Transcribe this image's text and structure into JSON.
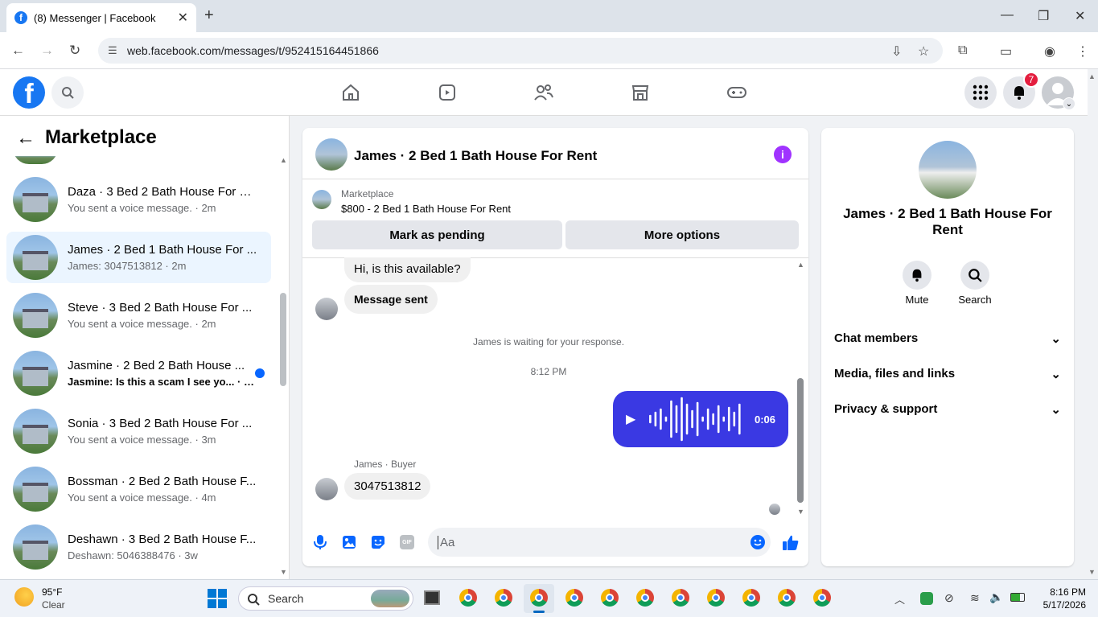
{
  "browser": {
    "tab_title": "(8) Messenger | Facebook",
    "favicon": "f",
    "url": "web.facebook.com/messages/t/952415164451866"
  },
  "fb_header": {
    "logo": "f",
    "notification_count": "7"
  },
  "left_panel": {
    "title": "Marketplace",
    "conversations": [
      {
        "name": "Daza · 3 Bed 2 Bath House For R...",
        "preview": "You sent a voice message. · 2m",
        "selected": false,
        "unread": false
      },
      {
        "name": "James · 2 Bed 1 Bath House For ...",
        "preview": "James: 3047513812 · 2m",
        "selected": true,
        "unread": false
      },
      {
        "name": "Steve · 3 Bed 2 Bath House For ...",
        "preview": "You sent a voice message. · 2m",
        "selected": false,
        "unread": false
      },
      {
        "name": "Jasmine · 2 Bed 2 Bath House ...",
        "preview": "Jasmine: Is this a scam I see yo... · 3m",
        "selected": false,
        "unread": true
      },
      {
        "name": "Sonia · 3 Bed 2 Bath House For ...",
        "preview": "You sent a voice message. · 3m",
        "selected": false,
        "unread": false
      },
      {
        "name": "Bossman · 2 Bed 2 Bath House F...",
        "preview": "You sent a voice message. · 4m",
        "selected": false,
        "unread": false
      },
      {
        "name": "Deshawn · 3 Bed 2 Bath House F...",
        "preview": "Deshawn: 5046388476 · 3w",
        "selected": false,
        "unread": false
      }
    ]
  },
  "chat": {
    "title": "James · 2 Bed 1 Bath House For Rent",
    "marketplace_label": "Marketplace",
    "listing": "$800 - 2 Bed 1 Bath House For Rent",
    "mark_pending": "Mark as pending",
    "more_options": "More options",
    "messages": {
      "m1": "Hi, is this available?",
      "m2": "Message sent",
      "system": "James is waiting for your response.",
      "time": "8:12 PM",
      "voice_duration": "0:06",
      "sender_label": "James · Buyer",
      "m3": "3047513812"
    },
    "composer_placeholder": "Aa"
  },
  "right_panel": {
    "name": "James · 2 Bed 1 Bath House For Rent",
    "mute": "Mute",
    "search": "Search",
    "sections": [
      "Chat members",
      "Media, files and links",
      "Privacy & support"
    ]
  },
  "taskbar": {
    "weather_temp": "95°F",
    "weather_desc": "Clear",
    "search_label": "Search",
    "time": "8:16 PM",
    "date": "5/17/2026"
  },
  "colors": {
    "fb_blue": "#1877f2",
    "voice_bubble": "#3a39e3",
    "info_purple": "#a033ff",
    "selected_bg": "#ebf5ff"
  }
}
